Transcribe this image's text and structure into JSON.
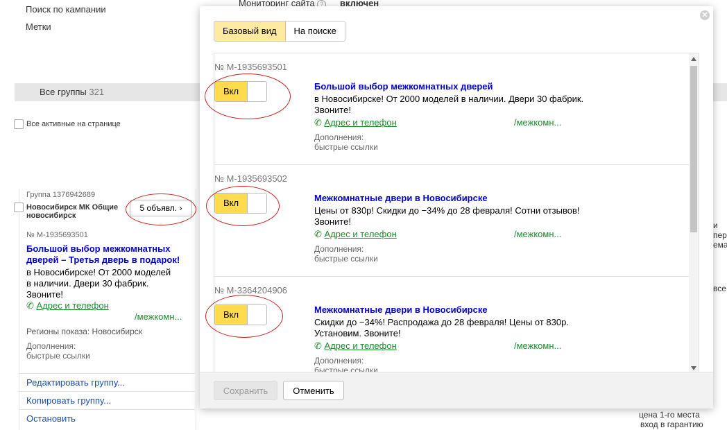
{
  "background": {
    "search_by_campaign": "Поиск по кампании",
    "labels": "Метки",
    "site_monitoring": "Мониторинг сайта",
    "site_monitoring_value": "включен",
    "all_groups_label": "Все группы",
    "all_groups_count": "321",
    "all_active_on_page": "Все активные на странице",
    "right_fragments": [
      "и пер",
      "ема",
      "все:"
    ],
    "bottom_right_1": "цена 1-го места",
    "bottom_right_2": "вход в гарантию"
  },
  "left_group": {
    "group_label": "Группа 1376942689",
    "group_name_1": "Новосибирск МК Общие",
    "group_name_2": "новосибирск",
    "ads_button": "5 объявл.",
    "ad_number": "№ M-1935693501",
    "ad_title_1": "Большой выбор межкомнатных",
    "ad_title_2": "дверей – Третья дверь в подарок!",
    "ad_text_1": "в Новосибирске! От 2000 моделей",
    "ad_text_2": "в наличии. Двери 30 фабрик.",
    "ad_text_3": "Звоните!",
    "contacts": "Адрес и телефон",
    "path": "/межкомн...",
    "regions": "Регионы показа: Новосибирск",
    "extras_label": "Дополнения:",
    "extras_value": "быстрые ссылки",
    "actions": [
      "Редактировать группу...",
      "Копировать группу...",
      "Остановить"
    ]
  },
  "modal": {
    "view_tabs": [
      "Базовый вид",
      "На поиске"
    ],
    "items": [
      {
        "number": "№ M-1935693501",
        "toggle": "Вкл",
        "title": "Большой выбор межкомнатных дверей",
        "text_1": "в Новосибирске! От 2000 моделей в наличии. Двери 30 фабрик.",
        "text_2": "Звоните!",
        "contacts": "Адрес и телефон",
        "path": "/межкомн...",
        "extras_label": "Дополнения:",
        "extras_value": "быстрые ссылки"
      },
      {
        "number": "№ M-1935693502",
        "toggle": "Вкл",
        "title": "Межкомнатные двери в Новосибирске",
        "text_1": "Цены от 830р! Скидки до −34% до 28 февраля! Сотни отзывов!",
        "text_2": "Звоните!",
        "contacts": "Адрес и телефон",
        "path": "/межкомн...",
        "extras_label": "Дополнения:",
        "extras_value": "быстрые ссылки"
      },
      {
        "number": "№ M-3364204906",
        "toggle": "Вкл",
        "title": "Межкомнатные двери в Новосибирске",
        "text_1": "Скидки до −34%! Распродажа до 28 февраля! Цены от 830р.",
        "text_2": "Установим. Звоните!",
        "contacts": "Адрес и телефон",
        "path": "/межкомн...",
        "extras_label": "Дополнения:",
        "extras_value": "быстрые ссылки"
      }
    ],
    "save_label": "Сохранить",
    "cancel_label": "Отменить"
  },
  "colors": {
    "accent_yellow": "#ffdb4d",
    "link_blue": "#0000cc",
    "link_green": "#1d8a2c",
    "annotation_red": "#cc1f1f"
  },
  "icons": [
    "help-icon",
    "phone-icon",
    "chevron-right-icon",
    "close-icon"
  ]
}
